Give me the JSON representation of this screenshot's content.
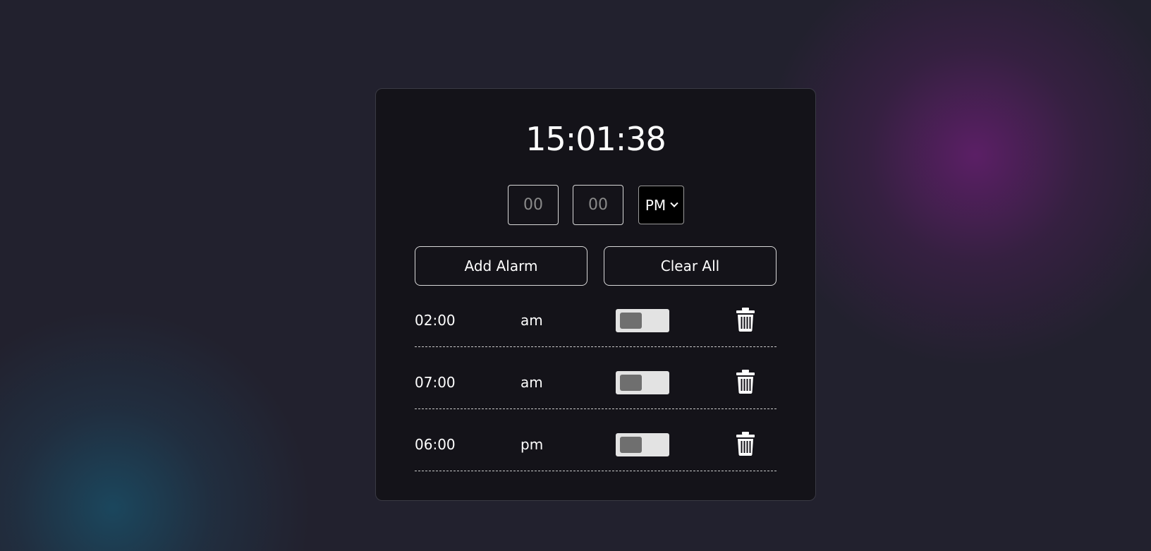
{
  "clock": {
    "time": "15:01:38"
  },
  "form": {
    "hour_placeholder": "00",
    "minute_placeholder": "00",
    "period_selected": "PM",
    "add_label": "Add Alarm",
    "clear_label": "Clear All"
  },
  "alarms": [
    {
      "time": "02:00",
      "period": "am",
      "enabled": false
    },
    {
      "time": "07:00",
      "period": "am",
      "enabled": false
    },
    {
      "time": "06:00",
      "period": "pm",
      "enabled": false
    }
  ],
  "icons": {
    "delete": "trash-icon",
    "dropdown": "chevron-down-icon"
  },
  "colors": {
    "background": "#22212e",
    "card": "#141319",
    "glow_purple": "#6e1e78",
    "glow_teal": "#195069",
    "toggle_track": "#e3e3e3",
    "toggle_knob": "#6f6f6f"
  }
}
